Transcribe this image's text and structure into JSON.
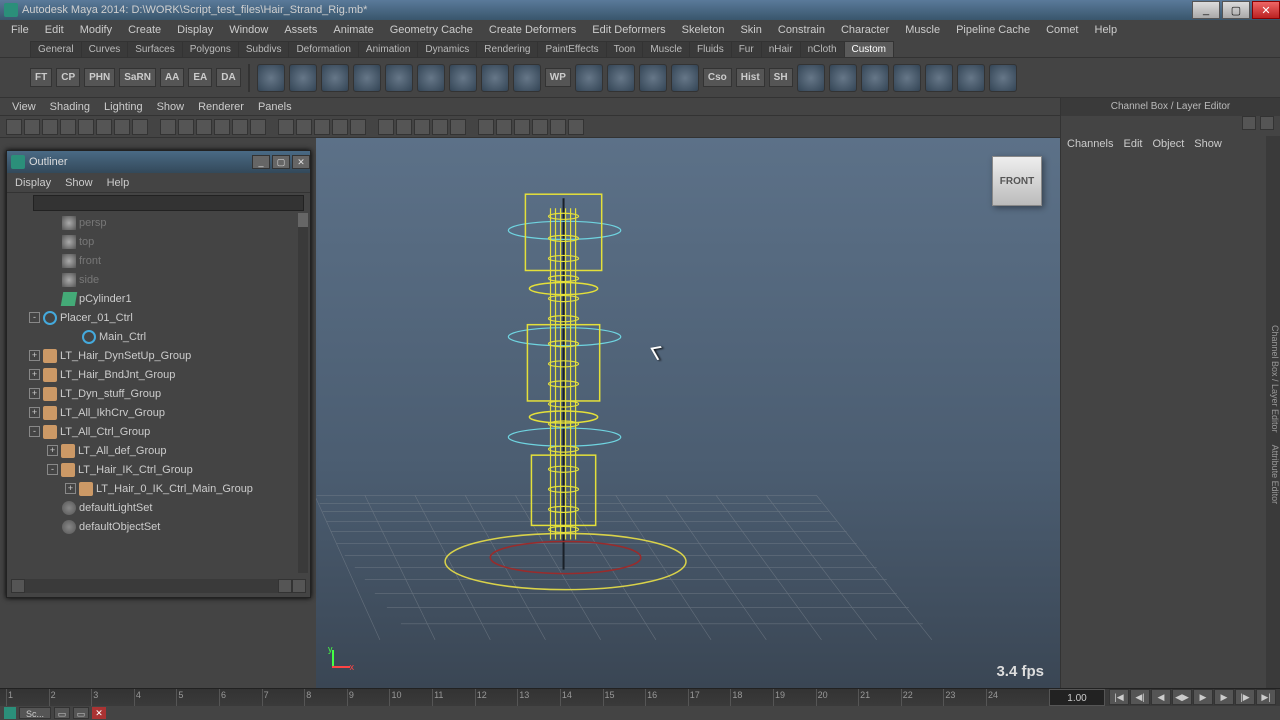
{
  "title": "Autodesk Maya 2014: D:\\WORK\\Script_test_files\\Hair_Strand_Rig.mb*",
  "mainmenu": [
    "File",
    "Edit",
    "Modify",
    "Create",
    "Display",
    "Window",
    "Assets",
    "Animate",
    "Geometry Cache",
    "Create Deformers",
    "Edit Deformers",
    "Skeleton",
    "Skin",
    "Constrain",
    "Character",
    "Muscle",
    "Pipeline Cache",
    "Comet",
    "Help"
  ],
  "shelftabs": [
    "General",
    "Curves",
    "Surfaces",
    "Polygons",
    "Subdivs",
    "Deformation",
    "Animation",
    "Dynamics",
    "Rendering",
    "PaintEffects",
    "Toon",
    "Muscle",
    "Fluids",
    "Fur",
    "nHair",
    "nCloth",
    "Custom"
  ],
  "shelftab_active": "Custom",
  "shelf_text": [
    "FT",
    "CP",
    "PHN",
    "SaRN",
    "AA",
    "EA",
    "DA"
  ],
  "shelf_labeled_icons": [
    "WP",
    "Cso",
    "Hist",
    "SH"
  ],
  "panel_menu": [
    "View",
    "Shading",
    "Lighting",
    "Show",
    "Renderer",
    "Panels"
  ],
  "outliner": {
    "title": "Outliner",
    "menu": [
      "Display",
      "Show",
      "Help"
    ],
    "items": [
      {
        "ind": 36,
        "icon": "cam",
        "label": "persp",
        "dim": true
      },
      {
        "ind": 36,
        "icon": "cam",
        "label": "top",
        "dim": true
      },
      {
        "ind": 36,
        "icon": "cam",
        "label": "front",
        "dim": true
      },
      {
        "ind": 36,
        "icon": "cam",
        "label": "side",
        "dim": true
      },
      {
        "ind": 36,
        "icon": "mesh",
        "label": "pCylinder1"
      },
      {
        "ind": 18,
        "exp": "-",
        "icon": "curve",
        "label": "Placer_01_Ctrl"
      },
      {
        "ind": 56,
        "icon": "curve",
        "label": "Main_Ctrl"
      },
      {
        "ind": 18,
        "exp": "+",
        "icon": "grp",
        "label": "LT_Hair_DynSetUp_Group"
      },
      {
        "ind": 18,
        "exp": "+",
        "icon": "grp",
        "label": "LT_Hair_BndJnt_Group"
      },
      {
        "ind": 18,
        "exp": "+",
        "icon": "grp",
        "label": "LT_Dyn_stuff_Group"
      },
      {
        "ind": 18,
        "exp": "+",
        "icon": "grp",
        "label": "LT_All_IkhCrv_Group"
      },
      {
        "ind": 18,
        "exp": "-",
        "icon": "grp",
        "label": "LT_All_Ctrl_Group"
      },
      {
        "ind": 36,
        "exp": "+",
        "icon": "grp",
        "label": "LT_All_def_Group"
      },
      {
        "ind": 36,
        "exp": "-",
        "icon": "grp",
        "label": "LT_Hair_IK_Ctrl_Group"
      },
      {
        "ind": 54,
        "exp": "+",
        "icon": "grp",
        "label": "LT_Hair_0_IK_Ctrl_Main_Group"
      },
      {
        "ind": 36,
        "icon": "set",
        "label": "defaultLightSet"
      },
      {
        "ind": 36,
        "icon": "set",
        "label": "defaultObjectSet"
      }
    ]
  },
  "channelbox": {
    "title": "Channel Box / Layer Editor",
    "tabs": [
      "Channels",
      "Edit",
      "Object",
      "Show"
    ]
  },
  "viewport": {
    "cube": "FRONT",
    "fps": "3.4 fps",
    "axis_y": "y",
    "axis_x": "x"
  },
  "timeline": {
    "current": "1.00",
    "ticks": [
      "1",
      "2",
      "3",
      "4",
      "5",
      "6",
      "7",
      "8",
      "9",
      "10",
      "11",
      "12",
      "13",
      "14",
      "15",
      "16",
      "17",
      "18",
      "19",
      "20",
      "21",
      "22",
      "23",
      "24"
    ]
  },
  "taskbar": {
    "item": "Sc..."
  }
}
